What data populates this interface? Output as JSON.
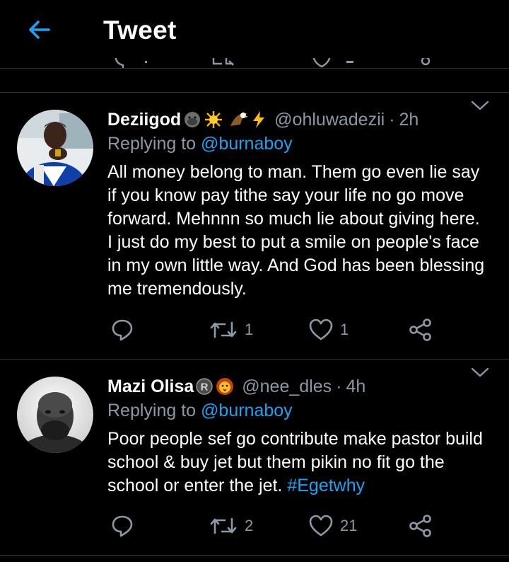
{
  "header": {
    "title": "Tweet"
  },
  "tweets": [
    {
      "name": "Deziigod",
      "handle": "@ohluwadezii",
      "separator": "·",
      "time": "2h",
      "replying_prefix": "Replying to",
      "replying_to": "@burnaboy",
      "text": "All money belong to man. Them go even lie say if you know pay tithe say your life no go move forward. Mehnnn so much lie about giving  here. I just do my best to put a smile on people's face in my own little way. And God has been blessing me tremendously.",
      "retweets": "1",
      "likes": "1",
      "badges": [
        "gorilla-emoji",
        "sun-emoji",
        "eagle-emoji",
        "lightning-emoji"
      ]
    },
    {
      "name": "Mazi Olisa",
      "handle": "@nee_dles",
      "separator": "·",
      "time": "4h",
      "replying_prefix": "Replying to",
      "replying_to": "@burnaboy",
      "text": "Poor people sef go contribute make pastor build school & buy jet but them pikin no fit go the school or enter the jet. ",
      "hashtag": "#Egetwhy",
      "retweets": "2",
      "likes": "21",
      "badges": [
        "registered-emoji",
        "lion-emoji"
      ]
    }
  ],
  "colors": {
    "background": "#000000",
    "accent": "#1da1f2",
    "secondary_text": "#8b98a5",
    "divider": "#2f3336"
  }
}
